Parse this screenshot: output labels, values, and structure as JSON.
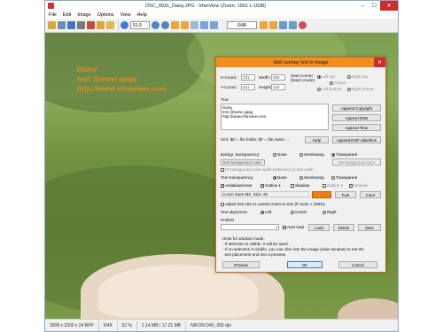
{
  "window": {
    "title": "DSC_0931_Daisy.JPG - IrfanView (Zoom: 1561 x 1038)"
  },
  "menu": [
    "File",
    "Edit",
    "Image",
    "Options",
    "View",
    "Help"
  ],
  "toolbar": {
    "zoom_value": "51.9",
    "page_value": "6/48"
  },
  "overlay_text_lines": [
    "Daisy",
    "test @www qqqq",
    "http://www.irfanview.com"
  ],
  "status": {
    "dimensions": "3008 x 2000 x 24 BPP",
    "page": "6/48",
    "zoom": "52 %",
    "size": "1.14 MB / 17.21 MB",
    "camera": "NIKON D40, 300 dpi"
  },
  "dialog": {
    "title": "Add overlay text to image",
    "xcoord_label": "X-Coord.:",
    "xcoord": "201",
    "width_label": "Width:",
    "width": "300",
    "ycoord_label": "Y-Coord.:",
    "ycoord": "201",
    "height_label": "Height:",
    "height": "100",
    "start_corner_label": "Start Corner:\n(batch mode)",
    "corner_left_top": "Left top",
    "corner_right_top": "Right top",
    "corner_center": "Center",
    "corner_left_bottom": "Left bottom",
    "corner_right_bottom": "Right bottom",
    "text_label": "Text:",
    "text_value": "Daisy\ntest @www qqqq\nhttp://www.irfanview.com",
    "append_copyright": "Append Copyright",
    "append_date": "Append Date",
    "append_time": "Append Time",
    "hint_folder": "Hint: $D = file folder, $F = file name ...",
    "help": "Help",
    "append_exif": "Append EXIF date/time",
    "backgr_transparency_label": "Backgr. transparency:",
    "opt_none": "None",
    "opt_semitransp": "Semitransp.",
    "opt_transparent": "Transparent",
    "text_bg_color": "Text background color:",
    "set_bg_color": "Set background color",
    "fit_bg_color": "Fit background color width (selection) to text width",
    "text_transparency_label": "Text transparency:",
    "antialiased": "Antialiased text",
    "outline1": "Outline 1",
    "shadow": "Shadow",
    "outline2": "Outline 2",
    "emboss": "Emboss",
    "font_desc": "Comic Sans MS, Size: 25",
    "font_btn": "Font",
    "color_btn": "Color",
    "font_color": "#f07f10",
    "adjust_font": "Adjust font size to current zoom-in size (if zoom < 100%)",
    "text_alignment_label": "Text alignment:",
    "align_left": "Left",
    "align_center": "Center",
    "align_right": "Right",
    "profiles_label": "Profiles",
    "auto_load": "Auto load",
    "load": "Load",
    "delete": "Delete",
    "save": "Save",
    "hints_title": "Hints for window mode:",
    "hint1": "- If selection is visible, it will be used.",
    "hint2": "- If no selection is visible, you can click into the image (main window) to set the",
    "hint3": "  text placement and see a preview.",
    "preview": "Preview",
    "ok": "OK",
    "cancel": "Cancel"
  }
}
